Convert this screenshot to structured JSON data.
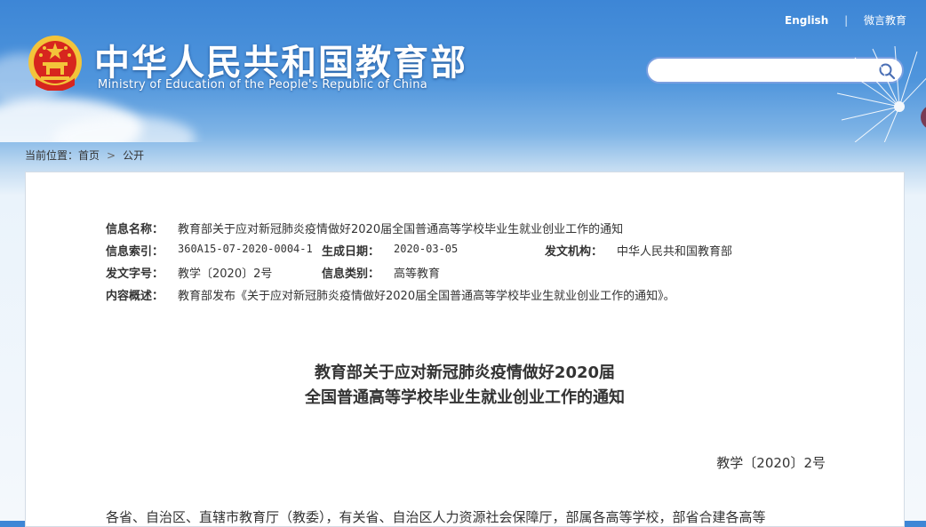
{
  "header": {
    "site_title": "中华人民共和国教育部",
    "site_subtitle": "Ministry of Education of the People's Republic of China",
    "links": {
      "english": "English",
      "weixin": "微言教育"
    },
    "search": {
      "placeholder": ""
    }
  },
  "breadcrumb": {
    "prefix": "当前位置：",
    "home": "首页",
    "separator": ">",
    "current": "公开"
  },
  "meta": {
    "info_name_label": "信息名称：",
    "info_name": "教育部关于应对新冠肺炎疫情做好2020届全国普通高等学校毕业生就业创业工作的通知",
    "index_label": "信息索引：",
    "index": "360A15-07-2020-0004-1",
    "date_label": "生成日期：",
    "date": "2020-03-05",
    "issuer_label": "发文机构：",
    "issuer": "中华人民共和国教育部",
    "doc_no_label": "发文字号：",
    "doc_no": "教学〔2020〕2号",
    "category_label": "信息类别：",
    "category": "高等教育",
    "summary_label": "内容概述：",
    "summary": "教育部发布《关于应对新冠肺炎疫情做好2020届全国普通高等学校毕业生就业创业工作的通知》。"
  },
  "document": {
    "title_line1": "教育部关于应对新冠肺炎疫情做好2020届",
    "title_line2": "全国普通高等学校毕业生就业创业工作的通知",
    "number": "教学〔2020〕2号",
    "body_first_line": "各省、自治区、直辖市教育厅（教委），有关省、自治区人力资源社会保障厅，部属各高等学校，部省合建各高等"
  },
  "colors": {
    "header_blue": "#3d86d6",
    "search_border": "#7a9fe0",
    "emblem_red": "#d7261e",
    "emblem_gold": "#f3c43a"
  },
  "icons": {
    "search": "search-icon",
    "emblem": "national-emblem-icon"
  }
}
